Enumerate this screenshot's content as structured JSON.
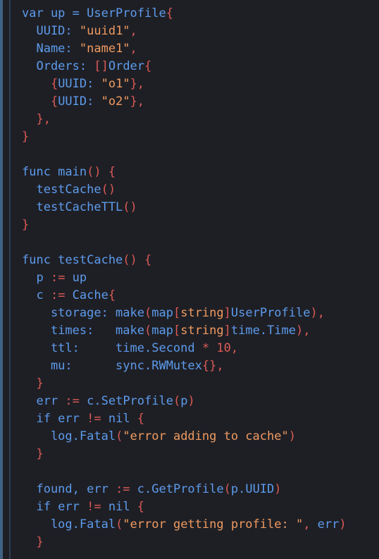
{
  "colors": {
    "background": "#1e1f25",
    "gutter": "#3f6283",
    "keyword": "#5d9bec",
    "punctuation": "#db5a56",
    "string": "#f09a5f",
    "plain": "#c8ccd4"
  },
  "code": {
    "lines": [
      {
        "tokens": [
          {
            "t": "var up = UserProfile",
            "c": "blue"
          },
          {
            "t": "{",
            "c": "red"
          }
        ]
      },
      {
        "tokens": [
          {
            "t": "  UUID: ",
            "c": "blue"
          },
          {
            "t": "\"uuid1\"",
            "c": "orange"
          },
          {
            "t": ",",
            "c": "red"
          }
        ]
      },
      {
        "tokens": [
          {
            "t": "  Name: ",
            "c": "blue"
          },
          {
            "t": "\"name1\"",
            "c": "orange"
          },
          {
            "t": ",",
            "c": "red"
          }
        ]
      },
      {
        "tokens": [
          {
            "t": "  Orders: ",
            "c": "blue"
          },
          {
            "t": "[]",
            "c": "red"
          },
          {
            "t": "Order",
            "c": "blue"
          },
          {
            "t": "{",
            "c": "red"
          }
        ]
      },
      {
        "tokens": [
          {
            "t": "    {",
            "c": "red"
          },
          {
            "t": "UUID: ",
            "c": "blue"
          },
          {
            "t": "\"o1\"",
            "c": "orange"
          },
          {
            "t": "},",
            "c": "red"
          }
        ]
      },
      {
        "tokens": [
          {
            "t": "    {",
            "c": "red"
          },
          {
            "t": "UUID: ",
            "c": "blue"
          },
          {
            "t": "\"o2\"",
            "c": "orange"
          },
          {
            "t": "},",
            "c": "red"
          }
        ]
      },
      {
        "tokens": [
          {
            "t": "  },",
            "c": "red"
          }
        ]
      },
      {
        "tokens": [
          {
            "t": "}",
            "c": "red"
          }
        ]
      },
      {
        "tokens": []
      },
      {
        "tokens": [
          {
            "t": "func main",
            "c": "blue"
          },
          {
            "t": "() {",
            "c": "red"
          }
        ]
      },
      {
        "tokens": [
          {
            "t": "  testCache",
            "c": "blue"
          },
          {
            "t": "()",
            "c": "red"
          }
        ]
      },
      {
        "tokens": [
          {
            "t": "  testCacheTTL",
            "c": "blue"
          },
          {
            "t": "()",
            "c": "red"
          }
        ]
      },
      {
        "tokens": [
          {
            "t": "}",
            "c": "red"
          }
        ]
      },
      {
        "tokens": []
      },
      {
        "tokens": [
          {
            "t": "func testCache",
            "c": "blue"
          },
          {
            "t": "() {",
            "c": "red"
          }
        ]
      },
      {
        "tokens": [
          {
            "t": "  p ",
            "c": "blue"
          },
          {
            "t": ":=",
            "c": "red"
          },
          {
            "t": " up",
            "c": "blue"
          }
        ]
      },
      {
        "tokens": [
          {
            "t": "  c ",
            "c": "blue"
          },
          {
            "t": ":=",
            "c": "red"
          },
          {
            "t": " Cache",
            "c": "blue"
          },
          {
            "t": "{",
            "c": "red"
          }
        ]
      },
      {
        "tokens": [
          {
            "t": "    storage: make",
            "c": "blue"
          },
          {
            "t": "(",
            "c": "red"
          },
          {
            "t": "map",
            "c": "blue"
          },
          {
            "t": "[",
            "c": "red"
          },
          {
            "t": "string",
            "c": "orange"
          },
          {
            "t": "]",
            "c": "red"
          },
          {
            "t": "UserProfile",
            "c": "blue"
          },
          {
            "t": "),",
            "c": "red"
          }
        ]
      },
      {
        "tokens": [
          {
            "t": "    times:   make",
            "c": "blue"
          },
          {
            "t": "(",
            "c": "red"
          },
          {
            "t": "map",
            "c": "blue"
          },
          {
            "t": "[",
            "c": "red"
          },
          {
            "t": "string",
            "c": "orange"
          },
          {
            "t": "]",
            "c": "red"
          },
          {
            "t": "time.Time",
            "c": "blue"
          },
          {
            "t": "),",
            "c": "red"
          }
        ]
      },
      {
        "tokens": [
          {
            "t": "    ttl:     time.Second ",
            "c": "blue"
          },
          {
            "t": "* 10,",
            "c": "red"
          }
        ]
      },
      {
        "tokens": [
          {
            "t": "    mu:      sync.RWMutex",
            "c": "blue"
          },
          {
            "t": "{},",
            "c": "red"
          }
        ]
      },
      {
        "tokens": [
          {
            "t": "  }",
            "c": "red"
          }
        ]
      },
      {
        "tokens": [
          {
            "t": "  err ",
            "c": "blue"
          },
          {
            "t": ":=",
            "c": "red"
          },
          {
            "t": " c.SetProfile",
            "c": "blue"
          },
          {
            "t": "(",
            "c": "red"
          },
          {
            "t": "p",
            "c": "blue"
          },
          {
            "t": ")",
            "c": "red"
          }
        ]
      },
      {
        "tokens": [
          {
            "t": "  if err ",
            "c": "blue"
          },
          {
            "t": "!=",
            "c": "red"
          },
          {
            "t": " nil ",
            "c": "blue"
          },
          {
            "t": "{",
            "c": "red"
          }
        ]
      },
      {
        "tokens": [
          {
            "t": "    log.Fatal",
            "c": "blue"
          },
          {
            "t": "(",
            "c": "red"
          },
          {
            "t": "\"error adding to cache\"",
            "c": "orange"
          },
          {
            "t": ")",
            "c": "red"
          }
        ]
      },
      {
        "tokens": [
          {
            "t": "  }",
            "c": "red"
          }
        ]
      },
      {
        "tokens": []
      },
      {
        "tokens": [
          {
            "t": "  found, err ",
            "c": "blue"
          },
          {
            "t": ":=",
            "c": "red"
          },
          {
            "t": " c.GetProfile",
            "c": "blue"
          },
          {
            "t": "(",
            "c": "red"
          },
          {
            "t": "p.UUID",
            "c": "blue"
          },
          {
            "t": ")",
            "c": "red"
          }
        ]
      },
      {
        "tokens": [
          {
            "t": "  if err ",
            "c": "blue"
          },
          {
            "t": "!=",
            "c": "red"
          },
          {
            "t": " nil ",
            "c": "blue"
          },
          {
            "t": "{",
            "c": "red"
          }
        ]
      },
      {
        "tokens": [
          {
            "t": "    log.Fatal",
            "c": "blue"
          },
          {
            "t": "(",
            "c": "red"
          },
          {
            "t": "\"error getting profile: \"",
            "c": "orange"
          },
          {
            "t": ", ",
            "c": "red"
          },
          {
            "t": "err",
            "c": "blue"
          },
          {
            "t": ")",
            "c": "red"
          }
        ]
      },
      {
        "tokens": [
          {
            "t": "  }",
            "c": "red"
          }
        ]
      }
    ]
  }
}
